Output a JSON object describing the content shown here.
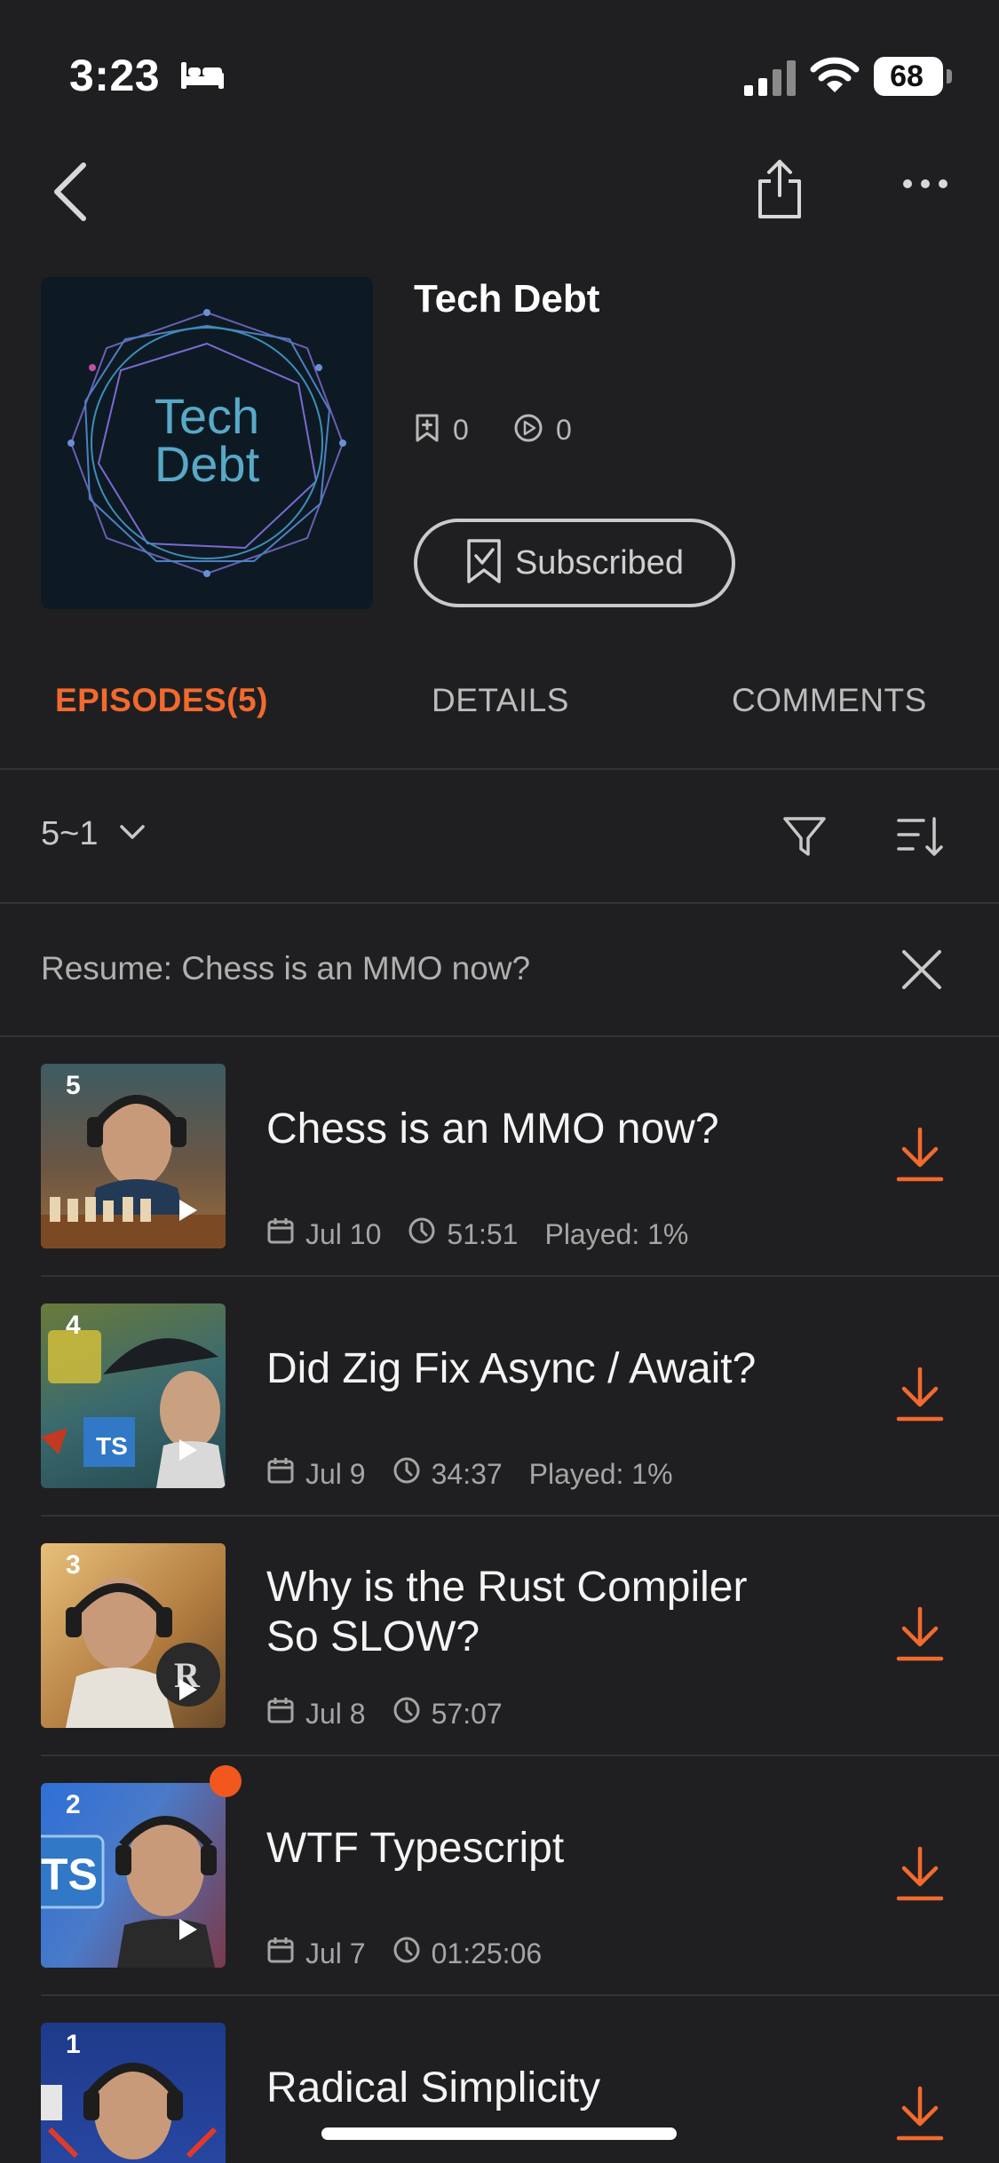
{
  "status_bar": {
    "time": "3:23",
    "battery": "68"
  },
  "podcast": {
    "artwork_text_line1": "Tech",
    "artwork_text_line2": "Debt",
    "title": "Tech Debt",
    "saved_count": "0",
    "plays_count": "0",
    "subscribe_label": "Subscribed"
  },
  "tabs": [
    {
      "label": "EPISODES(5)",
      "active": true
    },
    {
      "label": "DETAILS",
      "active": false
    },
    {
      "label": "COMMENTS",
      "active": false
    }
  ],
  "toolbar": {
    "range": "5~1"
  },
  "resume": {
    "text": "Resume: Chess is an MMO now?"
  },
  "episodes": [
    {
      "number": "5",
      "title": "Chess is an MMO now?",
      "date": "Jul 10",
      "duration": "51:51",
      "played": "Played: 1%"
    },
    {
      "number": "4",
      "title": "Did Zig Fix Async / Await?",
      "date": "Jul 9",
      "duration": "34:37",
      "played": "Played: 1%"
    },
    {
      "number": "3",
      "title": "Why is the Rust Compiler So SLOW?",
      "date": "Jul 8",
      "duration": "57:07",
      "played": ""
    },
    {
      "number": "2",
      "title": "WTF Typescript",
      "date": "Jul 7",
      "duration": "01:25:06",
      "played": ""
    },
    {
      "number": "1",
      "title": "Radical Simplicity",
      "date": "",
      "duration": "",
      "played": ""
    }
  ],
  "colors": {
    "accent": "#f26a2e",
    "background": "#1f1f21",
    "new_dot": "#f2571e"
  },
  "icons": [
    "bed-icon",
    "signal-icon",
    "wifi-icon",
    "back-icon",
    "share-icon",
    "more-icon",
    "bookmark-icon",
    "play-circle-icon",
    "filter-icon",
    "sort-icon",
    "close-icon",
    "calendar-icon",
    "clock-icon",
    "download-icon",
    "play-icon"
  ]
}
